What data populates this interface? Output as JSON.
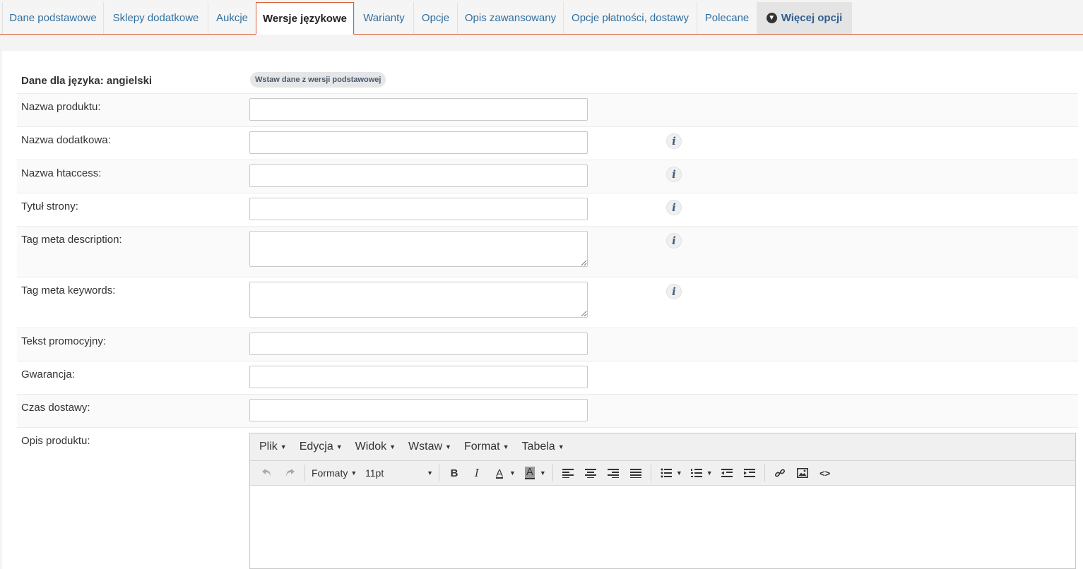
{
  "tabs": [
    {
      "label": "Dane podstawowe"
    },
    {
      "label": "Sklepy dodatkowe"
    },
    {
      "label": "Aukcje"
    },
    {
      "label": "Wersje językowe"
    },
    {
      "label": "Warianty"
    },
    {
      "label": "Opcje"
    },
    {
      "label": "Opis zawansowany"
    },
    {
      "label": "Opcje płatności, dostawy"
    },
    {
      "label": "Polecane"
    },
    {
      "label": "Więcej opcji"
    }
  ],
  "active_tab": "Wersje językowe",
  "form": {
    "header_label": "Dane dla języka: angielski",
    "insert_button": "Wstaw dane z wersji podstawowej",
    "fields": [
      {
        "label": "Nazwa produktu:",
        "value": "",
        "info": false
      },
      {
        "label": "Nazwa dodatkowa:",
        "value": "",
        "info": true
      },
      {
        "label": "Nazwa htaccess:",
        "value": "",
        "info": true
      },
      {
        "label": "Tytuł strony:",
        "value": "",
        "info": true
      },
      {
        "label": "Tag meta description:",
        "value": "",
        "info": true
      },
      {
        "label": "Tag meta keywords:",
        "value": "",
        "info": true
      },
      {
        "label": "Tekst promocyjny:",
        "value": "",
        "info": false
      },
      {
        "label": "Gwarancja:",
        "value": "",
        "info": false
      },
      {
        "label": "Czas dostawy:",
        "value": "",
        "info": false
      },
      {
        "label": "Opis produktu:"
      }
    ],
    "info_glyph": "i"
  },
  "editor": {
    "menu": [
      "Plik",
      "Edycja",
      "Widok",
      "Wstaw",
      "Format",
      "Tabela"
    ],
    "formats_label": "Formaty",
    "font_size": "11pt"
  },
  "colors": {
    "accent": "#d9603b",
    "tab_text": "#2f6fa0"
  }
}
